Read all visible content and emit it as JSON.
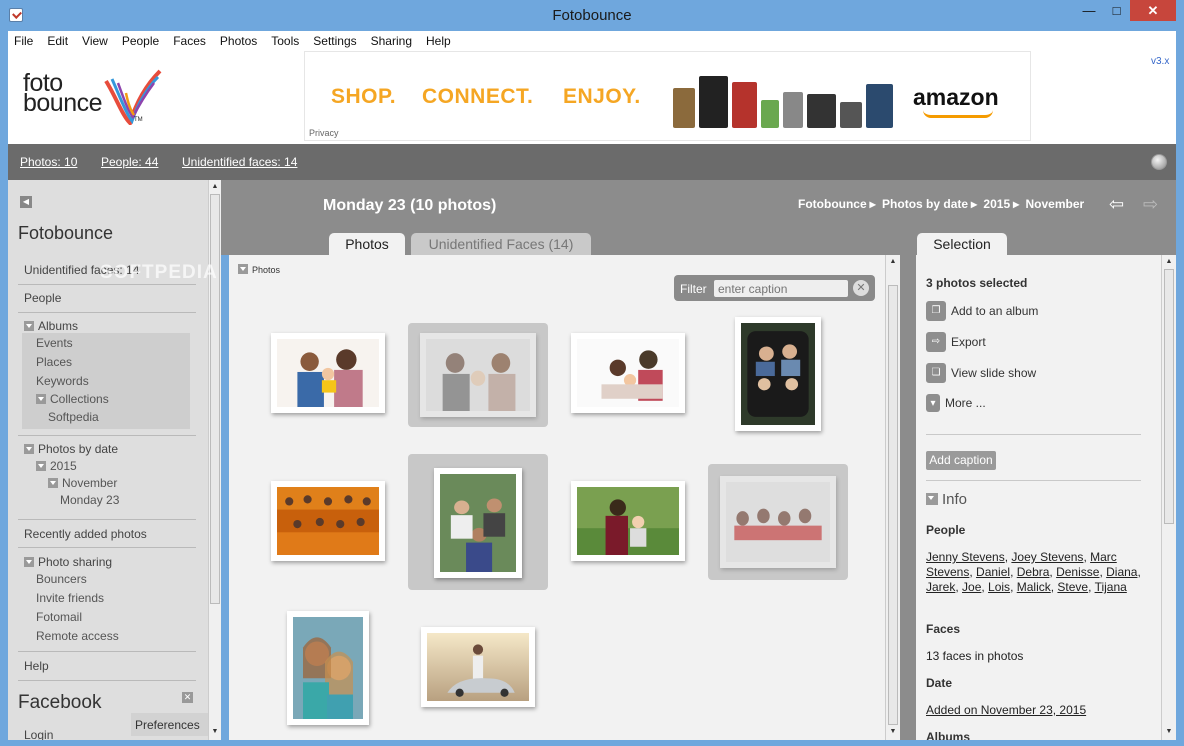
{
  "window": {
    "title": "Fotobounce"
  },
  "menu": [
    "File",
    "Edit",
    "View",
    "People",
    "Faces",
    "Photos",
    "Tools",
    "Settings",
    "Sharing",
    "Help"
  ],
  "banner": {
    "logo_line1": "foto",
    "logo_line2": "bounce",
    "tm": "TM",
    "ad_words": [
      "SHOP.",
      "CONNECT.",
      "ENJOY."
    ],
    "ad_brand": "amazon",
    "privacy": "Privacy",
    "version": "v3.x"
  },
  "stats": {
    "photos": "Photos: 10",
    "people": "People: 44",
    "unidentified": "Unidentified faces: 14"
  },
  "sidebar": {
    "title": "Fotobounce",
    "unidentified": "Unidentified faces: 14",
    "people": "People",
    "albums": "Albums",
    "album_items": [
      "Events",
      "Places",
      "Keywords"
    ],
    "collections": "Collections",
    "softpedia": "Softpedia",
    "photos_by_date": "Photos by date",
    "year": "2015",
    "month": "November",
    "day": "Monday 23",
    "recently_added": "Recently added photos",
    "photo_sharing": "Photo sharing",
    "sharing_items": [
      "Bouncers",
      "Invite friends",
      "Fotomail",
      "Remote access"
    ],
    "help": "Help",
    "facebook": "Facebook",
    "preferences": "Preferences",
    "login": "Login",
    "watermark": "SOFTPEDIA"
  },
  "main": {
    "day_title": "Monday 23 (10 photos)",
    "breadcrumb": [
      "Fotobounce",
      "Photos by date",
      "2015",
      "November"
    ],
    "tabs": {
      "photos": "Photos",
      "faces": "Unidentified Faces (14)",
      "selection": "Selection"
    },
    "photos_toggle": "Photos",
    "filter_label": "Filter",
    "filter_placeholder": "enter caption"
  },
  "selection": {
    "count": "3 photos selected",
    "actions": [
      "Add to an album",
      "Export",
      "View slide show",
      "More ..."
    ],
    "add_caption": "Add caption",
    "info": "Info",
    "people_heading": "People",
    "people": [
      "Jenny Stevens",
      "Joey Stevens",
      "Marc Stevens",
      "Daniel",
      "Debra",
      "Denisse",
      "Diana",
      "Jarek",
      "Joe",
      "Lois",
      "Malick",
      "Steve",
      "Tijana"
    ],
    "faces_heading": "Faces",
    "faces_text": "13 faces in photos",
    "date_heading": "Date",
    "date_text": "Added on November 23, 2015",
    "albums_heading": "Albums"
  },
  "colors": {
    "accent_dark": "#6b6b6b",
    "header_grey": "#8c8c8c",
    "ad_orange": "#f5a623",
    "titlebar": "#6fa7dd"
  }
}
